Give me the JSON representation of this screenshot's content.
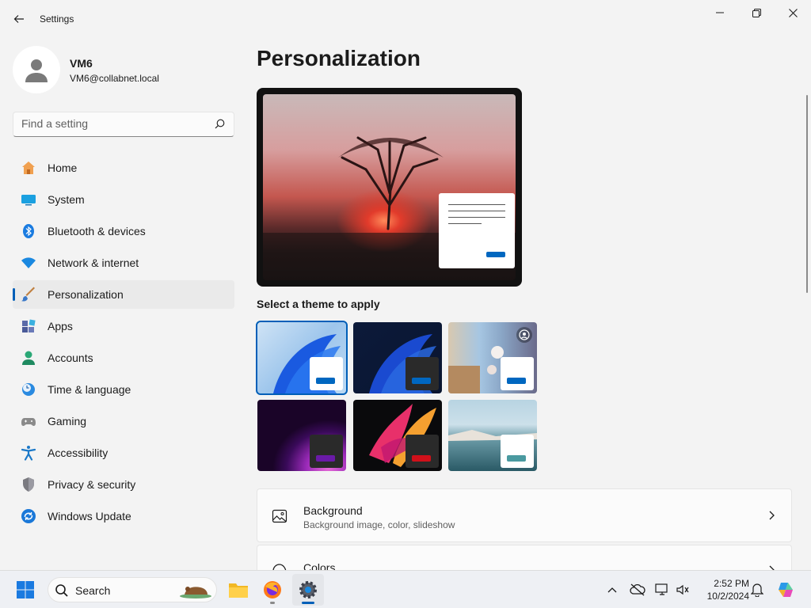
{
  "window": {
    "title": "Settings",
    "back_icon": "back-arrow-icon",
    "minimize_icon": "minimize-icon",
    "restore_icon": "restore-icon",
    "close_icon": "close-icon"
  },
  "user": {
    "name": "VM6",
    "email": "VM6@collabnet.local",
    "avatar_icon": "person-avatar-icon"
  },
  "search": {
    "placeholder": "Find a setting",
    "icon": "search-icon"
  },
  "sidebar": {
    "items": [
      {
        "label": "Home",
        "icon": "home-icon",
        "active": false
      },
      {
        "label": "System",
        "icon": "system-display-icon",
        "active": false
      },
      {
        "label": "Bluetooth & devices",
        "icon": "bluetooth-icon",
        "active": false
      },
      {
        "label": "Network & internet",
        "icon": "wifi-icon",
        "active": false
      },
      {
        "label": "Personalization",
        "icon": "paintbrush-icon",
        "active": true
      },
      {
        "label": "Apps",
        "icon": "apps-icon",
        "active": false
      },
      {
        "label": "Accounts",
        "icon": "accounts-icon",
        "active": false
      },
      {
        "label": "Time & language",
        "icon": "time-language-icon",
        "active": false
      },
      {
        "label": "Gaming",
        "icon": "gamepad-icon",
        "active": false
      },
      {
        "label": "Accessibility",
        "icon": "accessibility-icon",
        "active": false
      },
      {
        "label": "Privacy & security",
        "icon": "shield-icon",
        "active": false
      },
      {
        "label": "Windows Update",
        "icon": "windows-update-icon",
        "active": false
      }
    ],
    "accent_color": "#005fb8"
  },
  "main": {
    "title": "Personalization",
    "preview_icon": "desktop-preview-image",
    "themes_heading": "Select a theme to apply",
    "themes": [
      {
        "name": "windows-light",
        "selected": true,
        "button_color": "#0067c0"
      },
      {
        "name": "windows-dark",
        "selected": false,
        "button_color": "#0067c0"
      },
      {
        "name": "windows-spotlight",
        "selected": false,
        "button_color": "#0067c0",
        "badge_icon": "spotlight-icon"
      },
      {
        "name": "glow",
        "selected": false,
        "button_color": "#6a1aa8"
      },
      {
        "name": "captured-motion",
        "selected": false,
        "button_color": "#d0101a"
      },
      {
        "name": "flow",
        "selected": false,
        "button_color": "#4a9aa0"
      }
    ],
    "cards": [
      {
        "title": "Background",
        "subtitle": "Background image, color, slideshow",
        "icon": "background-image-icon",
        "chevron": "chevron-right-icon"
      },
      {
        "title": "Colors",
        "subtitle": "",
        "icon": "palette-icon",
        "chevron": "chevron-right-icon"
      }
    ]
  },
  "taskbar": {
    "start_icon": "windows-start-icon",
    "search_label": "Search",
    "search_icon": "search-icon",
    "apps": [
      {
        "name": "file-explorer-icon",
        "running": false
      },
      {
        "name": "firefox-icon",
        "running": true
      },
      {
        "name": "settings-gear-icon",
        "running": true,
        "active": true
      }
    ],
    "tray": [
      "chevron-up-icon",
      "onedrive-offline-icon",
      "network-icon",
      "volume-icon",
      "notifications-bell-icon",
      "copilot-icon"
    ],
    "time": "2:52 PM",
    "date": "10/2/2024"
  }
}
